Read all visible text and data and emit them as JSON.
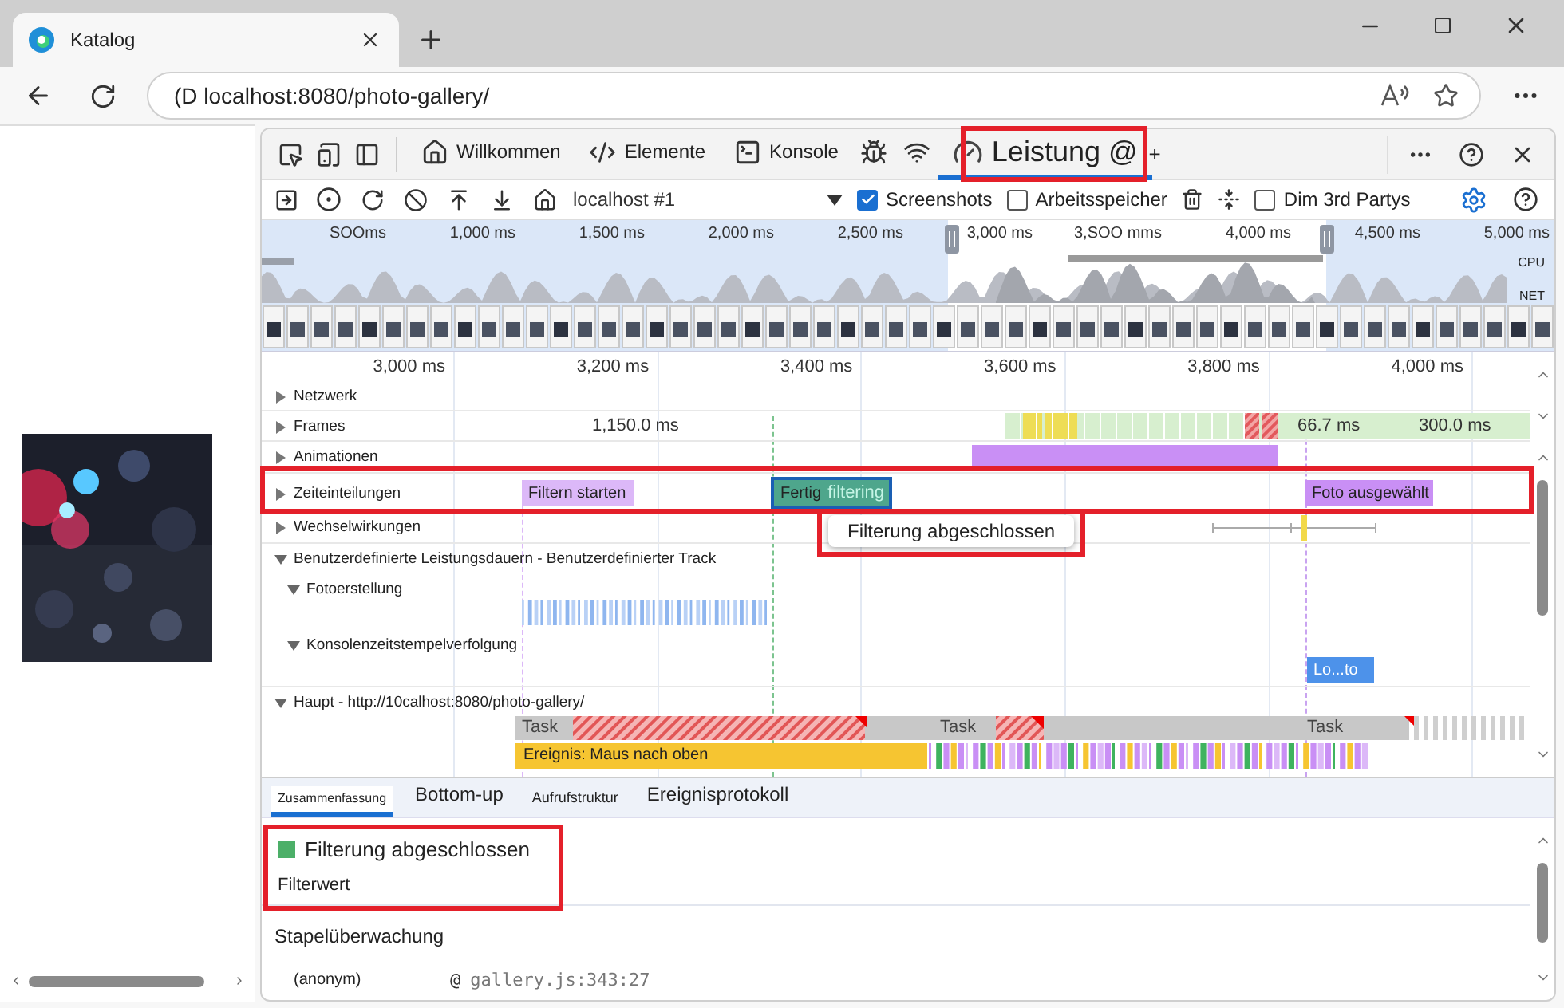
{
  "browser": {
    "tab_title": "Katalog",
    "address": "(D localhost:8080/photo-gallery/"
  },
  "devtools": {
    "tabs": [
      {
        "kind": "labeled",
        "label": "Willkommen",
        "selected": false
      },
      {
        "kind": "labeled",
        "label": "Elemente",
        "selected": false
      },
      {
        "kind": "labeled",
        "label": "Konsole",
        "selected": false
      },
      {
        "kind": "icon",
        "selected": false
      },
      {
        "kind": "icon",
        "selected": false
      },
      {
        "kind": "labeled",
        "label": "Leistung @",
        "selected": true
      }
    ],
    "add_tab": "+",
    "toolbar": {
      "target": "localhost #1",
      "checkboxes": [
        {
          "label": "Screenshots",
          "checked": true
        },
        {
          "label": "Arbeitsspeicher",
          "checked": false
        },
        {
          "label": "Dim 3rd Partys",
          "checked": false
        }
      ]
    },
    "overview": {
      "ticks": [
        "SOOms",
        "1,000 ms",
        "1,500 ms",
        "2,000 ms",
        "2,500 ms",
        "3,000 ms",
        "3,SOO mms",
        "4,000 ms",
        "4,500 ms",
        "5,000 ms"
      ],
      "cpu_label": "CPU",
      "net_label": "NET"
    },
    "ruler": [
      "3,000 ms",
      "3,200 ms",
      "3,400 ms",
      "3,600 ms",
      "3,800 ms",
      "4,000 ms"
    ],
    "tracks": [
      {
        "kind": "network",
        "label": "Netzwerk",
        "expanded": false
      },
      {
        "kind": "frames",
        "label": "Frames",
        "expanded": false,
        "readings": [
          "1,150.0 ms",
          "66.7 ms",
          "300.0 ms"
        ]
      },
      {
        "kind": "animations",
        "label": "Animationen",
        "expanded": false
      },
      {
        "kind": "timings",
        "label": "Zeiteinteilungen",
        "expanded": false,
        "events": [
          {
            "label": "Filtern starten",
            "color": "#dcb8f8",
            "selected": false
          },
          {
            "label": "Fertig",
            "sublabel": "filtering",
            "color": "#4ea68c",
            "selected": true
          },
          {
            "label": "Foto ausgewählt",
            "color": "#c98ff5",
            "selected": false
          }
        ]
      },
      {
        "kind": "interactions",
        "label": "Wechselwirkungen",
        "expanded": false,
        "tooltip": "Filterung abgeschlossen"
      },
      {
        "kind": "custom",
        "label": "Benutzerdefinierte Leistungsdauern - Benutzerdefinierter Track",
        "expanded": true,
        "children": [
          {
            "label": "Fotoerstellung",
            "expanded": true
          },
          {
            "label": "Konsolenzeitstempelverfolgung",
            "expanded": true,
            "events": [
              {
                "label": "Lo...to",
                "color": "#4d92ea"
              }
            ]
          }
        ]
      },
      {
        "kind": "main",
        "label": "Haupt - http://10calhost:8080/photo-gallery/",
        "expanded": true,
        "tasks": [
          "Task",
          "Task",
          "Task"
        ],
        "event": "Ereignis: Maus nach oben"
      }
    ],
    "bottom_tabs": [
      {
        "label": "Zusammenfassung",
        "selected": true
      },
      {
        "label": "Bottom-up",
        "selected": false
      },
      {
        "label": "Aufrufstruktur",
        "selected": false
      },
      {
        "label": "Ereignisprotokoll",
        "selected": false
      }
    ],
    "summary": {
      "title": "Filterung abgeschlossen",
      "color": "#4caf68",
      "detail": "Filterwert",
      "stack_heading": "Stapelüberwachung",
      "frames": [
        {
          "function": "(anonym)",
          "at": "@",
          "location": "gallery.js:343:27"
        }
      ]
    }
  }
}
